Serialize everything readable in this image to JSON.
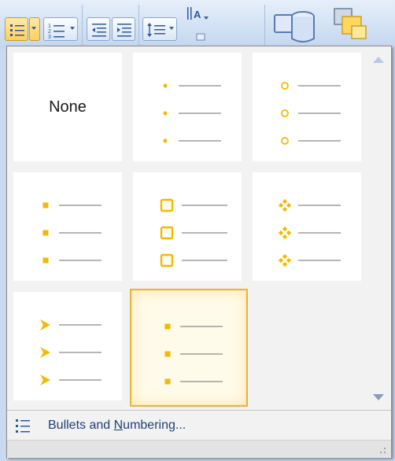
{
  "ribbon": {
    "buttons": [
      {
        "name": "bullets-button",
        "icon": "bullet-list-icon",
        "active": true
      },
      {
        "name": "bullets-dropdown",
        "icon": "chevron-down-icon",
        "active": true
      },
      {
        "name": "numbering-button",
        "icon": "numbered-list-icon",
        "active": false
      },
      {
        "name": "decrease-indent-button",
        "icon": "decrease-indent-icon",
        "active": false
      },
      {
        "name": "increase-indent-button",
        "icon": "increase-indent-icon",
        "active": false
      },
      {
        "name": "line-spacing-button",
        "icon": "line-spacing-icon",
        "active": false
      },
      {
        "name": "text-direction-button",
        "icon": "text-direction-icon",
        "active": false
      }
    ],
    "shapes_icon": "shapes-icon",
    "arrange_icon": "arrange-icon"
  },
  "gallery": {
    "none_label": "None",
    "tiles": [
      {
        "id": "none",
        "style": "none"
      },
      {
        "id": "filled-round",
        "style": "dot"
      },
      {
        "id": "hollow-round",
        "style": "circle"
      },
      {
        "id": "filled-square",
        "style": "square"
      },
      {
        "id": "hollow-square",
        "style": "hollow-square"
      },
      {
        "id": "star",
        "style": "diamonds"
      },
      {
        "id": "arrow",
        "style": "arrow"
      },
      {
        "id": "small-square",
        "style": "square",
        "selected": true
      }
    ],
    "bullet_color": "#f5b800",
    "line_color": "#6e6e6e"
  },
  "footer": {
    "label_pre": "Bullets and ",
    "label_accel": "N",
    "label_post": "umbering..."
  },
  "colors": {
    "accent": "#e7b440",
    "link": "#1f3f77"
  }
}
